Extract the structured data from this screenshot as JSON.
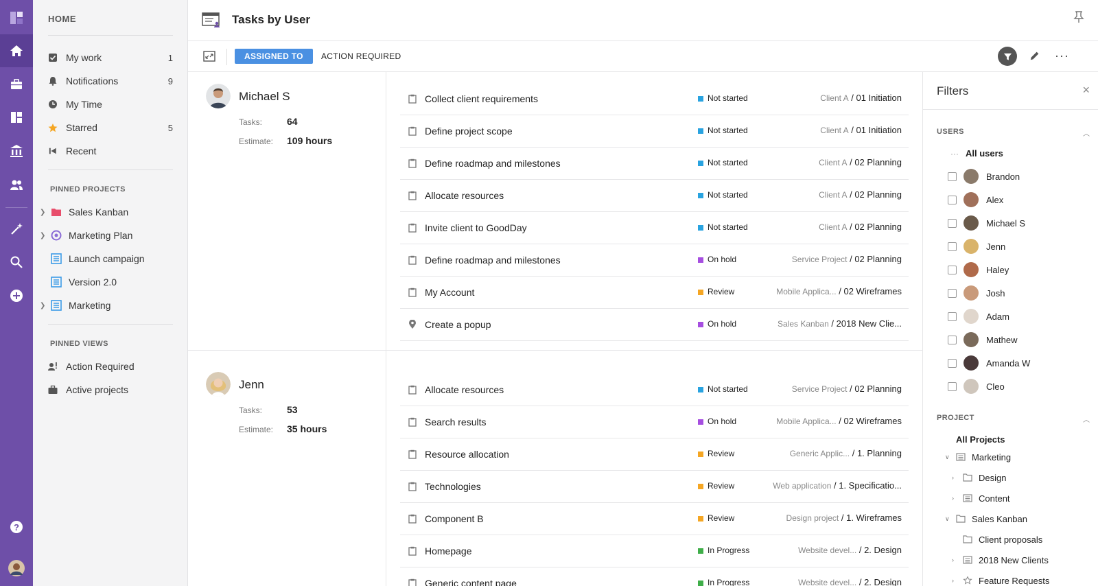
{
  "header": {
    "title": "Tasks by User"
  },
  "toolbar": {
    "tab_assigned": "ASSIGNED TO",
    "tab_action": "ACTION REQUIRED",
    "more": "···"
  },
  "sidebar": {
    "home": "HOME",
    "items": [
      {
        "label": "My work",
        "count": "1"
      },
      {
        "label": "Notifications",
        "count": "9"
      },
      {
        "label": "My Time",
        "count": ""
      },
      {
        "label": "Starred",
        "count": "5"
      },
      {
        "label": "Recent",
        "count": ""
      }
    ],
    "pinned_projects_title": "PINNED PROJECTS",
    "pinned_projects": [
      {
        "label": "Sales Kanban"
      },
      {
        "label": "Marketing Plan"
      },
      {
        "label": "Launch campaign"
      },
      {
        "label": "Version 2.0"
      },
      {
        "label": "Marketing"
      }
    ],
    "pinned_views_title": "PINNED VIEWS",
    "pinned_views": [
      {
        "label": "Action Required"
      },
      {
        "label": "Active projects"
      }
    ]
  },
  "labels": {
    "tasks": "Tasks:",
    "estimate": "Estimate:"
  },
  "users": [
    {
      "name": "Michael S",
      "tasks": "64",
      "estimate": "109 hours",
      "rows": [
        {
          "name": "Collect client requirements",
          "status": "Not started",
          "project": "Client A",
          "stage": "/ 01 Initiation"
        },
        {
          "name": "Define project scope",
          "status": "Not started",
          "project": "Client A",
          "stage": "/ 01 Initiation"
        },
        {
          "name": "Define roadmap and milestones",
          "status": "Not started",
          "project": "Client A",
          "stage": "/ 02 Planning"
        },
        {
          "name": "Allocate resources",
          "status": "Not started",
          "project": "Client A",
          "stage": "/ 02 Planning"
        },
        {
          "name": "Invite client to GoodDay",
          "status": "Not started",
          "project": "Client A",
          "stage": "/ 02 Planning"
        },
        {
          "name": "Define roadmap and milestones",
          "status": "On hold",
          "project": "Service Project",
          "stage": "/ 02 Planning"
        },
        {
          "name": "My Account",
          "status": "Review",
          "project": "Mobile Applica...",
          "stage": "/ 02 Wireframes"
        },
        {
          "name": "Create a popup",
          "status": "On hold",
          "project": "Sales Kanban",
          "stage": "/ 2018 New Clie..."
        }
      ]
    },
    {
      "name": "Jenn",
      "tasks": "53",
      "estimate": "35 hours",
      "rows": [
        {
          "name": "Allocate resources",
          "status": "Not started",
          "project": "Service Project",
          "stage": "/ 02 Planning"
        },
        {
          "name": "Search results",
          "status": "On hold",
          "project": "Mobile Applica...",
          "stage": "/ 02 Wireframes"
        },
        {
          "name": "Resource allocation",
          "status": "Review",
          "project": "Generic Applic...",
          "stage": "/ 1. Planning"
        },
        {
          "name": "Technologies",
          "status": "Review",
          "project": "Web application",
          "stage": "/ 1. Specificatio..."
        },
        {
          "name": "Component B",
          "status": "Review",
          "project": "Design project",
          "stage": "/ 1. Wireframes"
        },
        {
          "name": "Homepage",
          "status": "In Progress",
          "project": "Website devel...",
          "stage": "/ 2. Design"
        },
        {
          "name": "Generic content page",
          "status": "In Progress",
          "project": "Website devel...",
          "stage": "/ 2. Design"
        }
      ]
    }
  ],
  "status_colors": {
    "Not started": "#29a3e0",
    "On hold": "#a64ee0",
    "Review": "#f5a623",
    "In Progress": "#3fae49"
  },
  "filters": {
    "title": "Filters",
    "close": "×",
    "users_title": "USERS",
    "all_users": "All users",
    "users": [
      "Brandon",
      "Alex",
      "Michael S",
      "Jenn",
      "Haley",
      "Josh",
      "Adam",
      "Mathew",
      "Amanda W",
      "Cleo"
    ],
    "project_title": "PROJECT",
    "all_projects": "All Projects",
    "projects": [
      {
        "label": "Marketing"
      },
      {
        "label": "Design"
      },
      {
        "label": "Content"
      },
      {
        "label": "Sales Kanban"
      },
      {
        "label": "Client proposals"
      },
      {
        "label": "2018 New Clients"
      },
      {
        "label": "Feature Requests"
      }
    ]
  }
}
